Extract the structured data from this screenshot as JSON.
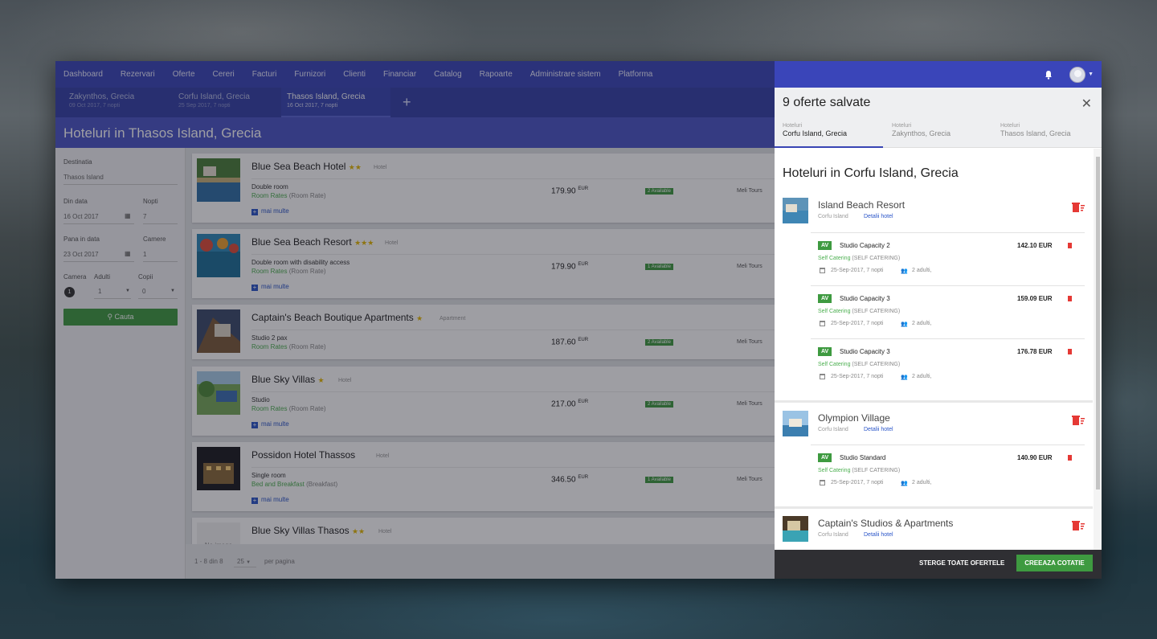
{
  "nav": {
    "items": [
      "Dashboard",
      "Rezervari",
      "Oferte",
      "Cereri",
      "Facturi",
      "Furnizori",
      "Clienti",
      "Financiar",
      "Catalog",
      "Rapoarte",
      "Administrare sistem",
      "Platforma"
    ]
  },
  "search_tabs": [
    {
      "title": "Zakynthos, Grecia",
      "subtitle": "09 Oct 2017, 7 nopti"
    },
    {
      "title": "Corfu Island, Grecia",
      "subtitle": "25 Sep 2017, 7 nopti"
    },
    {
      "title": "Thasos Island, Grecia",
      "subtitle": "16 Oct 2017, 7 nopti"
    }
  ],
  "page_title": "Hoteluri in Thasos Island, Grecia",
  "filter": {
    "destination_label": "Destinatia",
    "destination_value": "Thasos Island",
    "from_label": "Din data",
    "from_value": "16 Oct 2017",
    "nights_label": "Nopti",
    "nights_value": "7",
    "to_label": "Pana in data",
    "to_value": "23 Oct 2017",
    "rooms_label": "Camere",
    "rooms_value": "1",
    "room_label": "Camera",
    "room_number": "1",
    "adults_label": "Adulti",
    "adults_value": "1",
    "children_label": "Copii",
    "children_value": "0",
    "search_button": "Cauta"
  },
  "results": [
    {
      "name": "Blue Sea Beach Hotel",
      "stars": "★★",
      "type": "Hotel",
      "room": "Double room",
      "rate": "Room Rates",
      "rate_detail": "(Room Rate)",
      "more": "mai multe",
      "price": "179.90",
      "currency": "EUR",
      "availability": "2 Available",
      "supplier": "Meli Tours"
    },
    {
      "name": "Blue Sea Beach Resort",
      "stars": "★★★",
      "type": "Hotel",
      "room": "Double room with disability access",
      "rate": "Room Rates",
      "rate_detail": "(Room Rate)",
      "more": "mai multe",
      "price": "179.90",
      "currency": "EUR",
      "availability": "1 Available",
      "supplier": "Meli Tours"
    },
    {
      "name": "Captain's Beach Boutique Apartments",
      "stars": "★",
      "type": "Apartment",
      "room": "Studio 2 pax",
      "rate": "Room Rates",
      "rate_detail": "(Room Rate)",
      "more": "",
      "price": "187.60",
      "currency": "EUR",
      "availability": "2 Available",
      "supplier": "Meli Tours"
    },
    {
      "name": "Blue Sky Villas",
      "stars": "★",
      "type": "Hotel",
      "room": "Studio",
      "rate": "Room Rates",
      "rate_detail": "(Room Rate)",
      "more": "mai multe",
      "price": "217.00",
      "currency": "EUR",
      "availability": "2 Available",
      "supplier": "Meli Tours"
    },
    {
      "name": "Possidon Hotel Thassos",
      "stars": "",
      "type": "Hotel",
      "room": "Single room",
      "rate": "Bed and Breakfast",
      "rate_detail": "(Breakfast)",
      "more": "mai multe",
      "price": "346.50",
      "currency": "EUR",
      "availability": "1 Available",
      "supplier": "Meli Tours"
    },
    {
      "name": "Blue Sky Villas Thasos",
      "stars": "★★",
      "type": "Hotel",
      "no_image": "No image"
    }
  ],
  "pagination": {
    "range": "1 - 8 din 8",
    "per_page_value": "25",
    "per_page_label": "per pagina"
  },
  "saved_panel": {
    "title": "9 oferte salvate",
    "tabs": [
      {
        "label": "Hoteluri",
        "destination": "Corfu Island, Grecia"
      },
      {
        "label": "Hoteluri",
        "destination": "Zakynthos, Grecia"
      },
      {
        "label": "Hoteluri",
        "destination": "Thasos Island, Grecia"
      }
    ],
    "body_title": "Hoteluri in Corfu Island, Grecia",
    "hotels": [
      {
        "name": "Island Beach Resort",
        "location": "Corfu Island",
        "details_link": "Detalii hotel",
        "offers": [
          {
            "badge": "AV",
            "room": "Studio Capacity 2",
            "price": "142.10 EUR",
            "meal": "Self Catering",
            "meal_detail": "(SELF CATERING)",
            "date": "25-Sep-2017, 7 nopti",
            "pax": "2 adulti,"
          },
          {
            "badge": "AV",
            "room": "Studio Capacity 3",
            "price": "159.09 EUR",
            "meal": "Self Catering",
            "meal_detail": "(SELF CATERING)",
            "date": "25-Sep-2017, 7 nopti",
            "pax": "2 adulti,"
          },
          {
            "badge": "AV",
            "room": "Studio Capacity 3",
            "price": "176.78 EUR",
            "meal": "Self Catering",
            "meal_detail": "(SELF CATERING)",
            "date": "25-Sep-2017, 7 nopti",
            "pax": "2 adulti,"
          }
        ]
      },
      {
        "name": "Olympion Village",
        "location": "Corfu Island",
        "details_link": "Detalii hotel",
        "offers": [
          {
            "badge": "AV",
            "room": "Studio Standard",
            "price": "140.90 EUR",
            "meal": "Self Catering",
            "meal_detail": "(SELF CATERING)",
            "date": "25-Sep-2017, 7 nopti",
            "pax": "2 adulti,"
          }
        ]
      },
      {
        "name": "Captain's Studios & Apartments",
        "location": "Corfu Island",
        "details_link": "Detalii hotel",
        "offers": []
      }
    ],
    "clear_button": "STERGE TOATE OFERTELE",
    "create_button": "CREEAZA COTATIE"
  }
}
